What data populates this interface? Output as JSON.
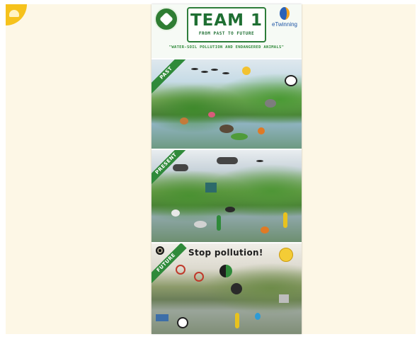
{
  "poster": {
    "title": "TEAM 1",
    "title_sub": "FROM PAST TO FUTURE",
    "partner_label": "eTwinning",
    "subtitle": "\"WATER-SOIL POLLUTION AND ENDANGERED ANIMALS\"",
    "sections": [
      {
        "label": "PAST"
      },
      {
        "label": "PRESENT"
      },
      {
        "label": "FUTURE",
        "slogan": "Stop pollution!"
      }
    ]
  },
  "icons": {
    "corner": "yellow-badge-icon",
    "logo_left": "green-heart-logo",
    "logo_right": "etwinning-logo"
  },
  "colors": {
    "page_background": "#fdf7e6",
    "brand_green": "#2f8a3a",
    "accent_yellow": "#f6c21c"
  }
}
